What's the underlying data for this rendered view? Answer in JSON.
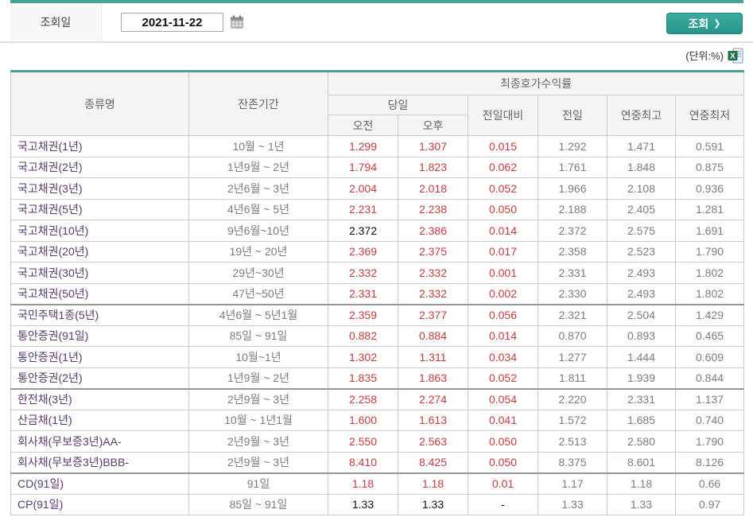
{
  "form": {
    "date_label": "조회일",
    "date_value": "2021-11-22",
    "search_label": "조회",
    "search_arrow": "❯"
  },
  "unit_note": "(단위:%)",
  "icons": {
    "calendar_icon": "calendar",
    "excel_icon": "excel-export"
  },
  "colors": {
    "accent_teal": "#4aa39a",
    "button_teal": "#2d9a90",
    "value_red": "#c53d3d",
    "bond_name_purple": "#5b3a6d",
    "muted_gray": "#7d7d7d",
    "value_black": "#111111",
    "header_bg": "#f4f4f4",
    "header_text": "#666666",
    "border": "#cccccc",
    "group_border": "#999999",
    "excel_green": "#1e7145"
  },
  "table": {
    "headers": {
      "type": "종류명",
      "period": "잔존기간",
      "yield_group": "최종호가수익률",
      "today": "당일",
      "am": "오전",
      "pm": "오후",
      "diff": "전일대비",
      "prev": "전일",
      "year_high": "연중최고",
      "year_low": "연중최저"
    },
    "rows": [
      {
        "name": "국고채권(1년)",
        "period": "10월 ~ 1년",
        "values": [
          "1.299",
          "1.307",
          "0.015",
          "1.292",
          "1.471",
          "0.591"
        ],
        "value_colors": [
          "red",
          "red",
          "red"
        ],
        "group_start": false
      },
      {
        "name": "국고채권(2년)",
        "period": "1년9월 ~ 2년",
        "values": [
          "1.794",
          "1.823",
          "0.062",
          "1.761",
          "1.848",
          "0.875"
        ],
        "value_colors": [
          "red",
          "red",
          "red"
        ],
        "group_start": false
      },
      {
        "name": "국고채권(3년)",
        "period": "2년6월 ~ 3년",
        "values": [
          "2.004",
          "2.018",
          "0.052",
          "1.966",
          "2.108",
          "0.936"
        ],
        "value_colors": [
          "red",
          "red",
          "red"
        ],
        "group_start": false
      },
      {
        "name": "국고채권(5년)",
        "period": "4년6월 ~ 5년",
        "values": [
          "2.231",
          "2.238",
          "0.050",
          "2.188",
          "2.405",
          "1.281"
        ],
        "value_colors": [
          "red",
          "red",
          "red"
        ],
        "group_start": false
      },
      {
        "name": "국고채권(10년)",
        "period": "9년6월~10년",
        "values": [
          "2.372",
          "2.386",
          "0.014",
          "2.372",
          "2.575",
          "1.691"
        ],
        "value_colors": [
          "black",
          "red",
          "red"
        ],
        "group_start": false
      },
      {
        "name": "국고채권(20년)",
        "period": "19년 ~ 20년",
        "values": [
          "2.369",
          "2.375",
          "0.017",
          "2.358",
          "2.523",
          "1.790"
        ],
        "value_colors": [
          "red",
          "red",
          "red"
        ],
        "group_start": false
      },
      {
        "name": "국고채권(30년)",
        "period": "29년~30년",
        "values": [
          "2.332",
          "2.332",
          "0.001",
          "2.331",
          "2.493",
          "1.802"
        ],
        "value_colors": [
          "red",
          "red",
          "red"
        ],
        "group_start": false
      },
      {
        "name": "국고채권(50년)",
        "period": "47년~50년",
        "values": [
          "2.331",
          "2.332",
          "0.002",
          "2.330",
          "2.493",
          "1.802"
        ],
        "value_colors": [
          "red",
          "red",
          "red"
        ],
        "group_start": false
      },
      {
        "name": "국민주택1종(5년)",
        "period": "4년6월 ~ 5년1월",
        "values": [
          "2.359",
          "2.377",
          "0.056",
          "2.321",
          "2.504",
          "1.429"
        ],
        "value_colors": [
          "red",
          "red",
          "red"
        ],
        "group_start": true
      },
      {
        "name": "통안증권(91일)",
        "period": "85일 ~ 91일",
        "values": [
          "0.882",
          "0.884",
          "0.014",
          "0.870",
          "0.893",
          "0.465"
        ],
        "value_colors": [
          "red",
          "red",
          "red"
        ],
        "group_start": false
      },
      {
        "name": "통안증권(1년)",
        "period": "10월~1년",
        "values": [
          "1.302",
          "1.311",
          "0.034",
          "1.277",
          "1.444",
          "0.609"
        ],
        "value_colors": [
          "red",
          "red",
          "red"
        ],
        "group_start": false
      },
      {
        "name": "통안증권(2년)",
        "period": "1년9월 ~ 2년",
        "values": [
          "1.835",
          "1.863",
          "0.052",
          "1.811",
          "1.939",
          "0.844"
        ],
        "value_colors": [
          "red",
          "red",
          "red"
        ],
        "group_start": false
      },
      {
        "name": "한전채(3년)",
        "period": "2년9월 ~ 3년",
        "values": [
          "2.258",
          "2.274",
          "0.054",
          "2.220",
          "2.331",
          "1.137"
        ],
        "value_colors": [
          "red",
          "red",
          "red"
        ],
        "group_start": true
      },
      {
        "name": "산금채(1년)",
        "period": "10월 ~ 1년1월",
        "values": [
          "1.600",
          "1.613",
          "0.041",
          "1.572",
          "1.685",
          "0.740"
        ],
        "value_colors": [
          "red",
          "red",
          "red"
        ],
        "group_start": false
      },
      {
        "name": "회사채(무보증3년)AA-",
        "period": "2년9월 ~ 3년",
        "values": [
          "2.550",
          "2.563",
          "0.050",
          "2.513",
          "2.580",
          "1.790"
        ],
        "value_colors": [
          "red",
          "red",
          "red"
        ],
        "group_start": false
      },
      {
        "name": "회사채(무보증3년)BBB-",
        "period": "2년9월 ~ 3년",
        "values": [
          "8.410",
          "8.425",
          "0.050",
          "8.375",
          "8.601",
          "8.126"
        ],
        "value_colors": [
          "red",
          "red",
          "red"
        ],
        "group_start": false
      },
      {
        "name": "CD(91일)",
        "period": "91일",
        "values": [
          "1.18",
          "1.18",
          "0.01",
          "1.17",
          "1.18",
          "0.66"
        ],
        "value_colors": [
          "red",
          "red",
          "red"
        ],
        "group_start": true
      },
      {
        "name": "CP(91일)",
        "period": "85일 ~ 91일",
        "values": [
          "1.33",
          "1.33",
          "-",
          "1.33",
          "1.33",
          "0.97"
        ],
        "value_colors": [
          "black",
          "black",
          "black"
        ],
        "group_start": false
      }
    ]
  }
}
